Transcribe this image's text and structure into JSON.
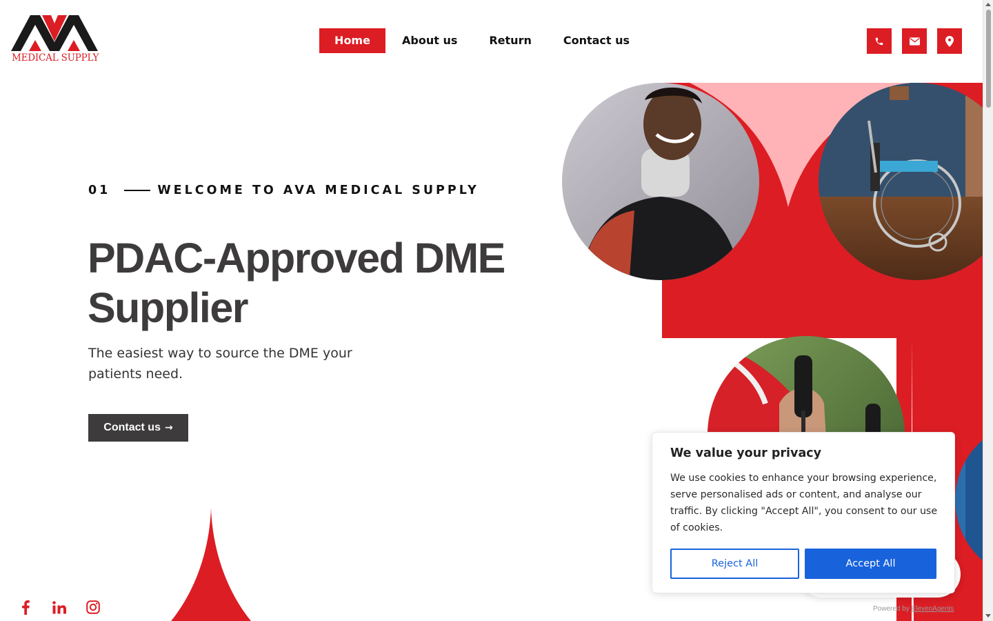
{
  "header": {
    "logo_text": "MEDICAL SUPPLY",
    "logo_letters": "AVA",
    "nav": [
      {
        "label": "Home",
        "active": true
      },
      {
        "label": "About us",
        "active": false
      },
      {
        "label": "Return",
        "active": false
      },
      {
        "label": "Contact us",
        "active": false
      }
    ],
    "icons": [
      "phone-icon",
      "envelope-icon",
      "map-pin-icon"
    ]
  },
  "hero": {
    "number": "01",
    "eyebrow": "WELCOME TO AVA MEDICAL SUPPLY",
    "title": "PDAC-Approved DME Supplier",
    "subtitle": "The easiest way to source the DME your patients need.",
    "cta_label": "Contact us",
    "cta_arrow": "→",
    "images": [
      "man-with-neck-brace-photo",
      "wheelchair-photo",
      "trekking-poles-photo",
      "blue-photo-partial"
    ]
  },
  "social": [
    "facebook-icon",
    "linkedin-icon",
    "instagram-icon"
  ],
  "cookie": {
    "title": "We value your privacy",
    "text": "We use cookies to enhance your browsing experience, serve personalised ads or content, and analyse our traffic. By clicking \"Accept All\", you consent to our use of cookies.",
    "reject_label": "Reject All",
    "accept_label": "Accept All"
  },
  "powered_by": {
    "prefix": "Powered by",
    "link": "ElevenAgents"
  },
  "colors": {
    "brand_red": "#dc1d24",
    "dark_gray": "#3d3b3c",
    "cookie_blue": "#1863dc",
    "light_pink": "#ffb3b6"
  }
}
